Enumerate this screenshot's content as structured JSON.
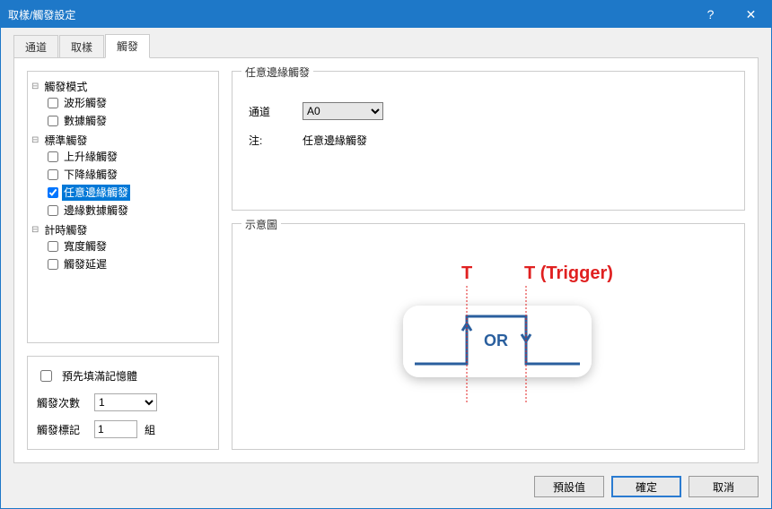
{
  "title": "取樣/觸發設定",
  "help": "?",
  "close": "✕",
  "tabs": {
    "t0": "通道",
    "t1": "取樣",
    "t2": "觸發"
  },
  "tree": {
    "g0": {
      "label": "觸發模式",
      "items": [
        "波形觸發",
        "數據觸發"
      ]
    },
    "g1": {
      "label": "標準觸發",
      "items": [
        "上升緣觸發",
        "下降緣觸發",
        "任意邊緣觸發",
        "邊緣數據觸發"
      ],
      "checked_index": 2,
      "selected_index": 2
    },
    "g2": {
      "label": "計時觸發",
      "items": [
        "寬度觸發",
        "觸發延遲"
      ]
    }
  },
  "options": {
    "prefill_label": "預先填滿記憶體",
    "count_label": "觸發次數",
    "count_value": "1",
    "mark_label": "觸發標記",
    "mark_value": "1",
    "mark_unit": "組"
  },
  "group_top": {
    "legend": "任意邊緣觸發",
    "channel_label": "通道",
    "channel_value": "A0",
    "note_label": "注:",
    "note_text": "任意邊緣觸發"
  },
  "group_bot": {
    "legend": "示意圖",
    "t1": "T",
    "t2": "T (Trigger)",
    "or": "OR"
  },
  "buttons": {
    "defaults": "預設值",
    "ok": "確定",
    "cancel": "取消"
  }
}
